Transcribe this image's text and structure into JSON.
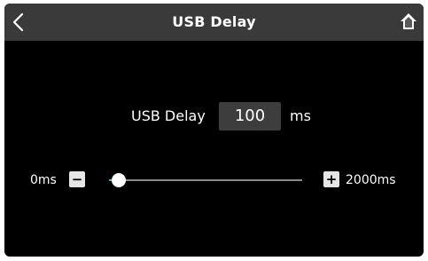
{
  "header": {
    "title": "USB Delay",
    "back_icon": "chevron-left-icon",
    "home_icon": "home-icon"
  },
  "delay": {
    "label": "USB Delay",
    "value": "100",
    "unit": "ms"
  },
  "slider": {
    "min_label": "0ms",
    "max_label": "2000ms",
    "minus_label": "−",
    "plus_label": "+",
    "min": 0,
    "max": 2000,
    "value": 100
  },
  "colors": {
    "header_bg": "#3a3a3a",
    "screen_bg": "#000000",
    "accent": "#2ec4b6",
    "value_box_bg": "#3d3d3d"
  }
}
